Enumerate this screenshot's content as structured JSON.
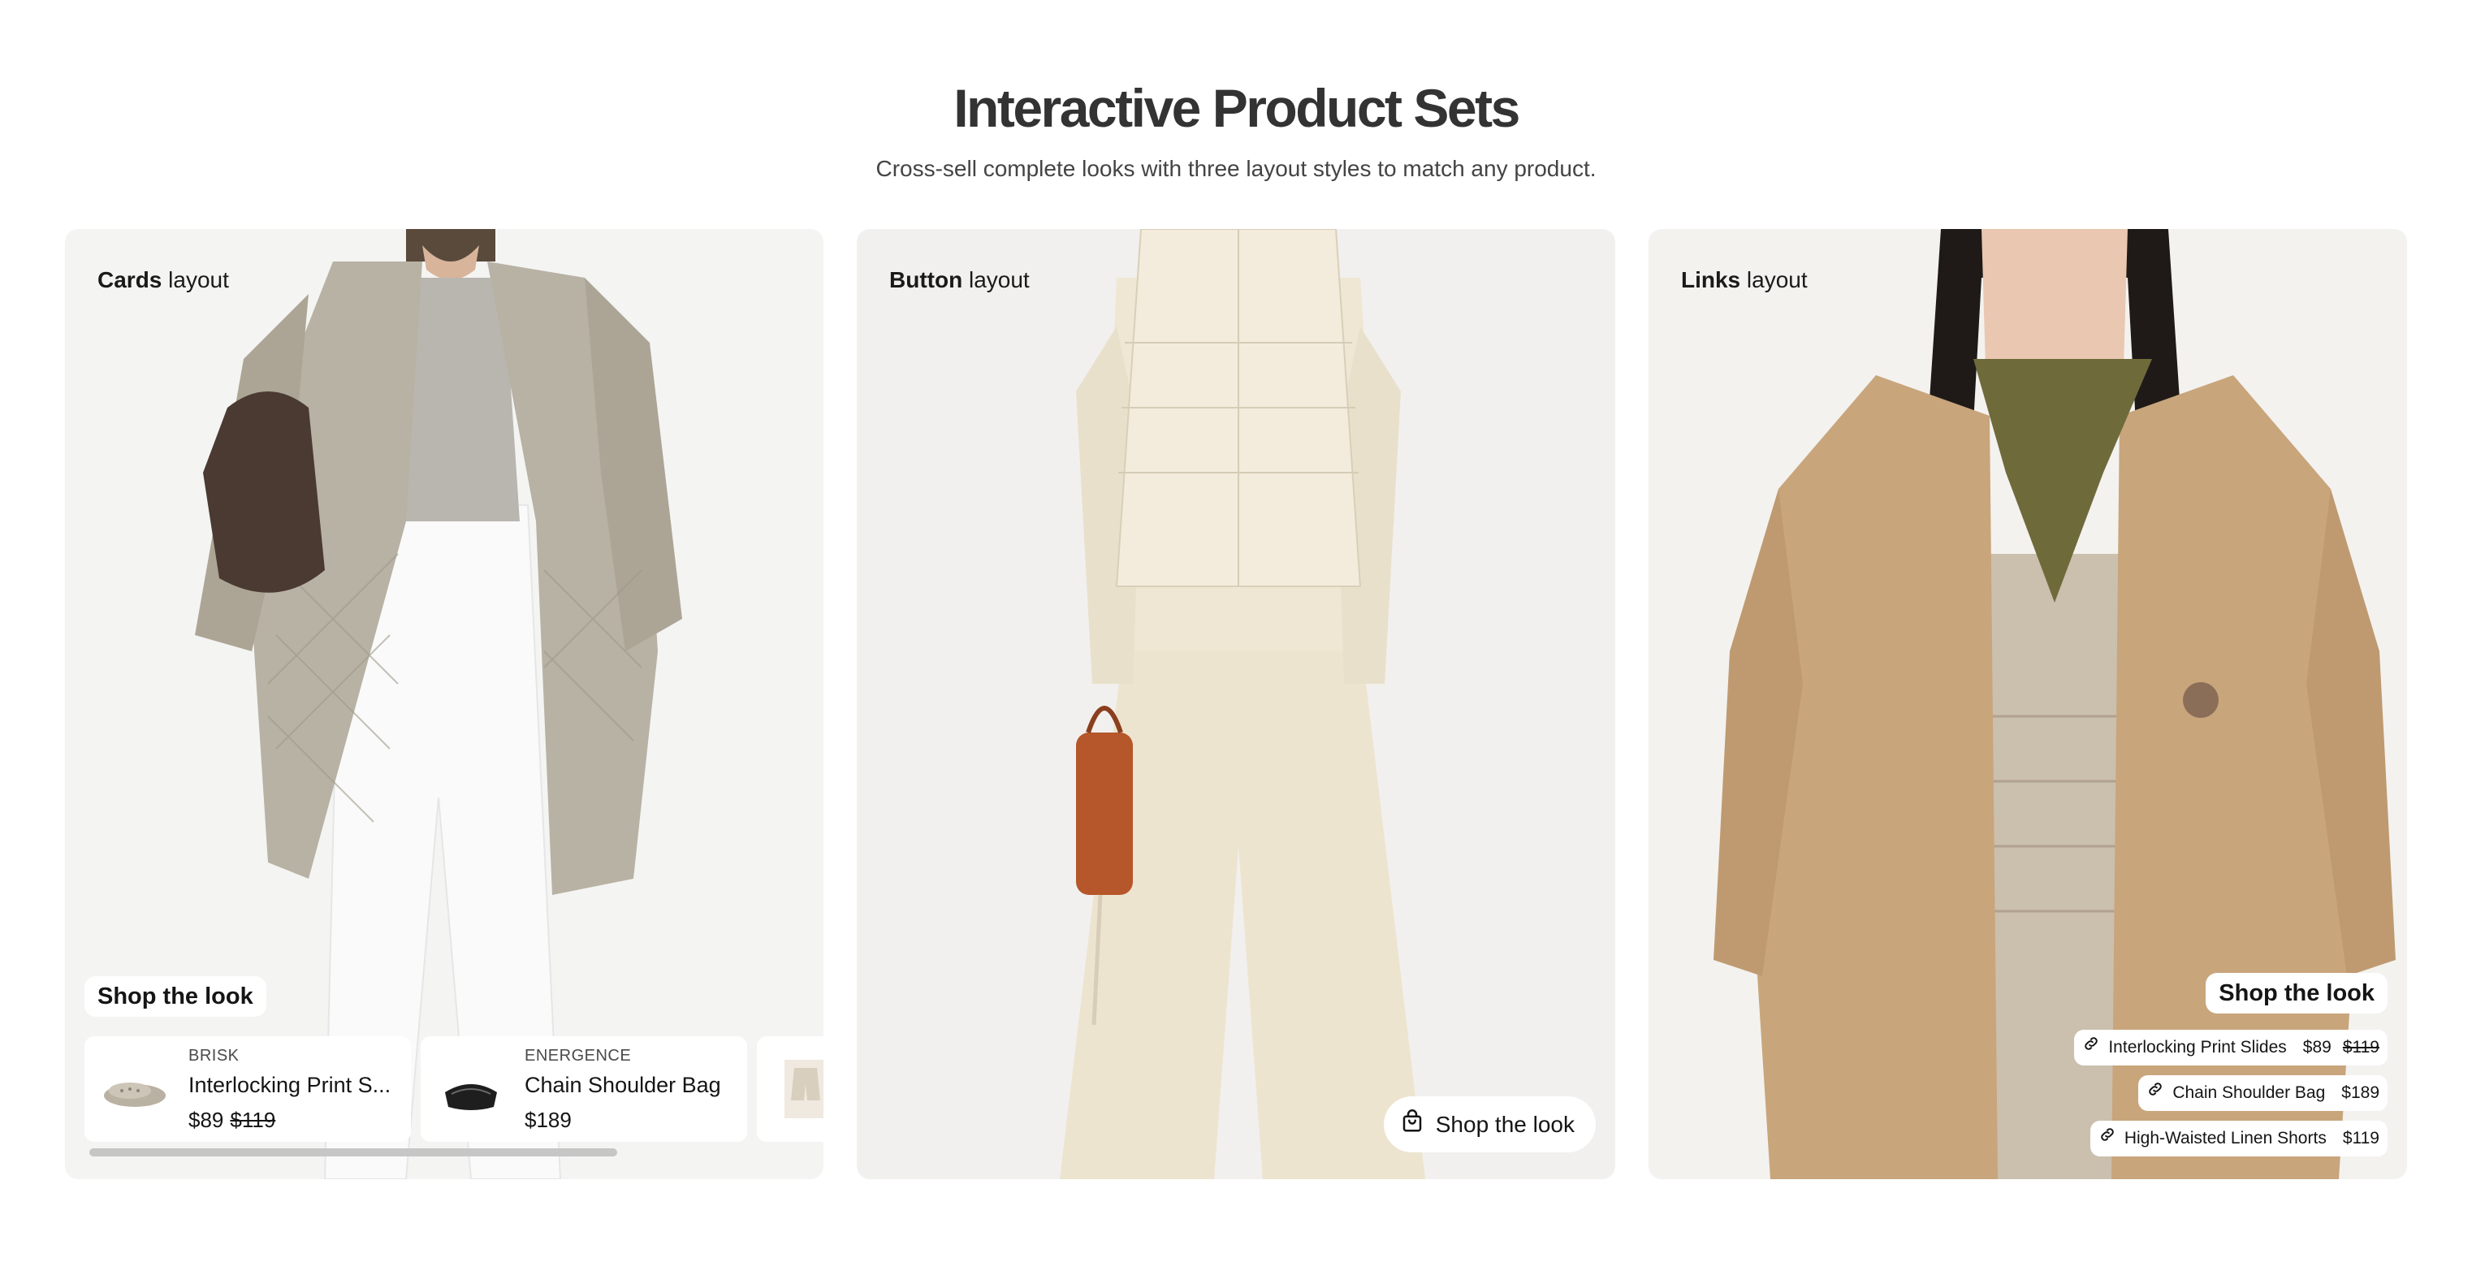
{
  "header": {
    "title": "Interactive Product Sets",
    "subtitle": "Cross-sell complete looks with three layout styles to match any product."
  },
  "panels": {
    "cards": {
      "label_bold": "Cards",
      "label_rest": " layout",
      "shop_label": "Shop the look",
      "items": [
        {
          "brand": "BRISK",
          "name": "Interlocking Print S...",
          "price": "$89",
          "compare_price": "$119",
          "icon": "slides-icon"
        },
        {
          "brand": "ENERGENCE",
          "name": "Chain Shoulder Bag",
          "price": "$189",
          "icon": "bag-icon"
        }
      ]
    },
    "button": {
      "label_bold": "Button",
      "label_rest": " layout",
      "shop_label": "Shop the look",
      "icon": "shopping-bag-icon"
    },
    "links": {
      "label_bold": "Links",
      "label_rest": " layout",
      "shop_label": "Shop the look",
      "items": [
        {
          "name": "Interlocking Print Slides",
          "price": "$89",
          "compare_price": "$119",
          "icon": "link-icon"
        },
        {
          "name": "Chain Shoulder Bag",
          "price": "$189",
          "icon": "link-icon"
        },
        {
          "name": "High-Waisted Linen Shorts",
          "price": "$119",
          "icon": "link-icon"
        }
      ]
    }
  },
  "colors": {
    "panel_bg": "#f4f4f3",
    "title": "#333333",
    "scrollbar": "#c6c6c6"
  }
}
